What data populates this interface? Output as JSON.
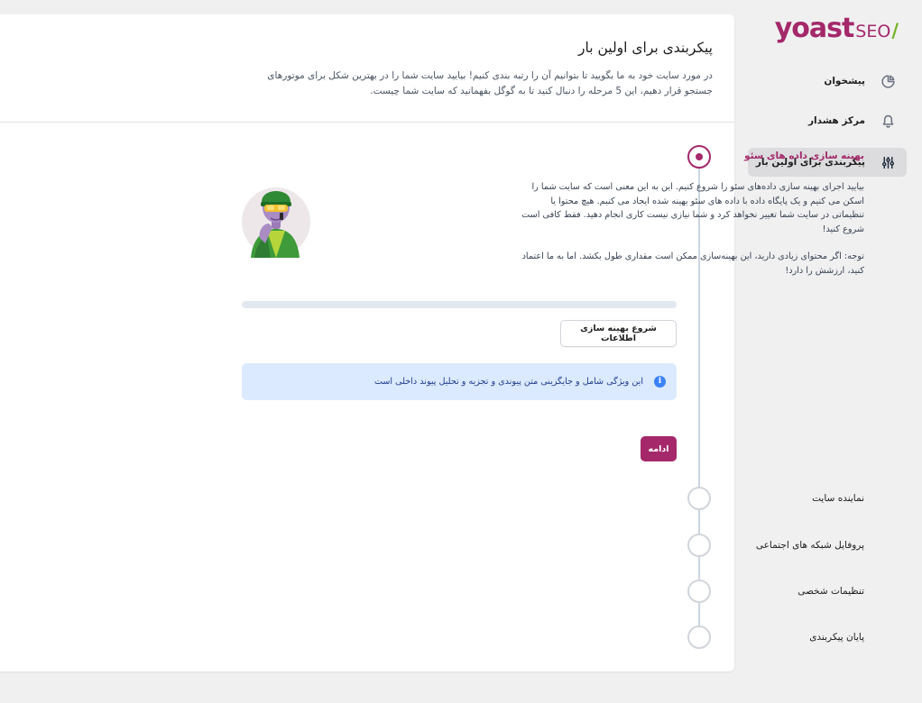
{
  "brand": {
    "logo_word": "yoast",
    "logo_seo": "SEO",
    "logo_slash": "/"
  },
  "sidebar": {
    "items": [
      {
        "label": "پیشخوان",
        "icon": "dashboard-pie-icon",
        "active": false
      },
      {
        "label": "مرکز هشدار",
        "icon": "bell-icon",
        "active": false
      },
      {
        "label": "پیکربندی برای اولین بار",
        "icon": "sliders-icon",
        "active": true
      }
    ]
  },
  "header": {
    "title": "پیکربندی برای اولین بار",
    "description": "در مورد سایت خود به ما بگویید تا بتوانیم آن را رتبه بندی کنیم! بیایید سایت شما را در بهترین شکل برای موتورهای جستجو قرار دهیم، این 5 مرحله را دنبال کنید تا به گوگل بفهمانید که سایت شما چیست."
  },
  "steps": [
    {
      "label": "بهینه سازی داده های سئو",
      "active": true
    },
    {
      "label": "نماینده سایت",
      "active": false
    },
    {
      "label": "پروفایل شبکه های اجتماعی",
      "active": false
    },
    {
      "label": "تنظیمات شخصی",
      "active": false
    },
    {
      "label": "پایان پیکربندی",
      "active": false
    }
  ],
  "step1": {
    "paragraph1": "بیایید اجرای بهینه سازی داده‌های سئو را شروع کنیم. این به این معنی است که سایت شما را اسکن می کنیم و یک پایگاه داده با داده های سئو بهینه شده ایجاد می کنیم. هیچ محتوا یا تنظیماتی در سایت شما تغییر نخواهد کرد و شما نیازی نیست کاری انجام دهید. فقط کافی است شروع کنید!",
    "paragraph2": "توجه: اگر محتوای زیادی دارید، این بهینه‌سازی ممکن است مقداری طول بکشد. اما به ما اعتماد کنید، ارزشش را دارد!",
    "progress": 0,
    "start_button": "شروع بهینه سازی اطلاعات",
    "info_text": "این ویژگی شامل و جایگزینی متن پیوندی و تجزیه و تحلیل پیوند داخلی است",
    "info_icon": "info-icon",
    "continue_button": "ادامه"
  },
  "colors": {
    "brand": "#a4286a",
    "info_bg": "#dbeafe",
    "info_icon": "#3b82f6",
    "rail": "#cbd5e1"
  }
}
